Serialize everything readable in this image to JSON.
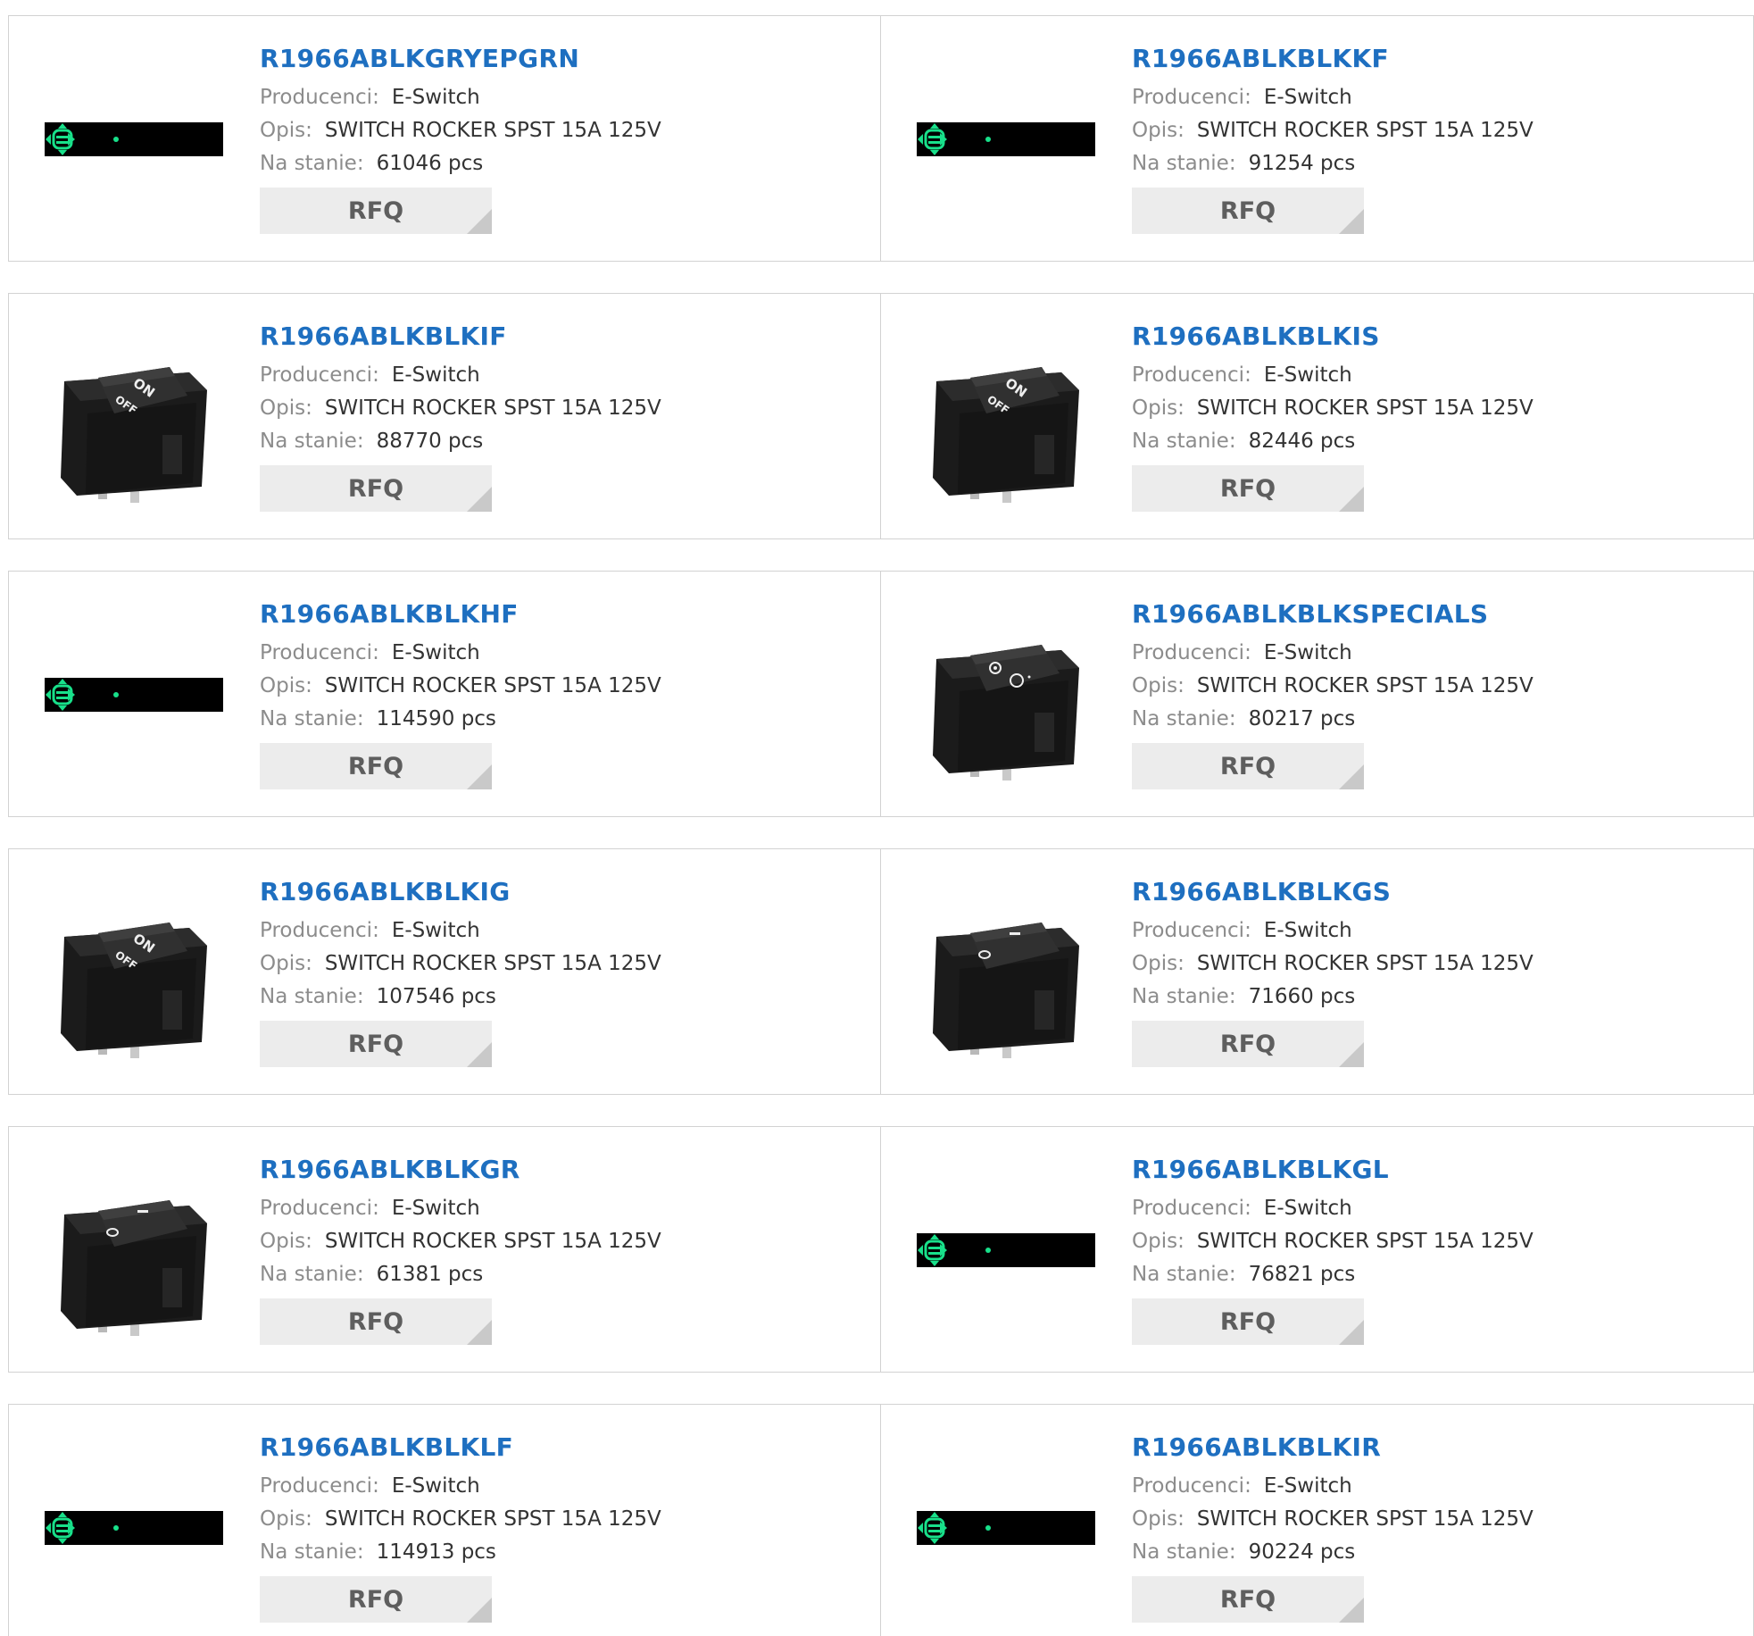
{
  "labels": {
    "manufacturer": "Producenci:",
    "description": "Opis:",
    "stock": "Na stanie:",
    "rfq": "RFQ"
  },
  "colors": {
    "title": "#1e6fc0",
    "label": "#8c8c8c",
    "value": "#333333",
    "button_bg": "#ececec",
    "button_text": "#5e5e5e",
    "placeholder_accent": "#18e08a"
  },
  "products": [
    {
      "part": "R1966ABLKGRYEPGRN",
      "manufacturer": "E-Switch",
      "description": "SWITCH ROCKER SPST 15A 125V",
      "stock": "61046 pcs",
      "image": "placeholder-icon"
    },
    {
      "part": "R1966ABLKBLKKF",
      "manufacturer": "E-Switch",
      "description": "SWITCH ROCKER SPST 15A 125V",
      "stock": "91254 pcs",
      "image": "placeholder-icon"
    },
    {
      "part": "R1966ABLKBLKIF",
      "manufacturer": "E-Switch",
      "description": "SWITCH ROCKER SPST 15A 125V",
      "stock": "88770 pcs",
      "image": "rocker-on-off-icon"
    },
    {
      "part": "R1966ABLKBLKIS",
      "manufacturer": "E-Switch",
      "description": "SWITCH ROCKER SPST 15A 125V",
      "stock": "82446 pcs",
      "image": "rocker-on-off-icon"
    },
    {
      "part": "R1966ABLKBLKHF",
      "manufacturer": "E-Switch",
      "description": "SWITCH ROCKER SPST 15A 125V",
      "stock": "114590 pcs",
      "image": "placeholder-icon"
    },
    {
      "part": "R1966ABLKBLKSPECIALS",
      "manufacturer": "E-Switch",
      "description": "SWITCH ROCKER SPST 15A 125V",
      "stock": "80217 pcs",
      "image": "rocker-symbol-icon"
    },
    {
      "part": "R1966ABLKBLKIG",
      "manufacturer": "E-Switch",
      "description": "SWITCH ROCKER SPST 15A 125V",
      "stock": "107546 pcs",
      "image": "rocker-on-off-icon"
    },
    {
      "part": "R1966ABLKBLKGS",
      "manufacturer": "E-Switch",
      "description": "SWITCH ROCKER SPST 15A 125V",
      "stock": "71660 pcs",
      "image": "rocker-io-icon"
    },
    {
      "part": "R1966ABLKBLKGR",
      "manufacturer": "E-Switch",
      "description": "SWITCH ROCKER SPST 15A 125V",
      "stock": "61381 pcs",
      "image": "rocker-io-icon"
    },
    {
      "part": "R1966ABLKBLKGL",
      "manufacturer": "E-Switch",
      "description": "SWITCH ROCKER SPST 15A 125V",
      "stock": "76821 pcs",
      "image": "placeholder-icon"
    },
    {
      "part": "R1966ABLKBLKLF",
      "manufacturer": "E-Switch",
      "description": "SWITCH ROCKER SPST 15A 125V",
      "stock": "114913 pcs",
      "image": "placeholder-icon"
    },
    {
      "part": "R1966ABLKBLKIR",
      "manufacturer": "E-Switch",
      "description": "SWITCH ROCKER SPST 15A 125V",
      "stock": "90224 pcs",
      "image": "placeholder-icon"
    }
  ],
  "switch_text": {
    "on": "ON",
    "off": "OFF"
  }
}
